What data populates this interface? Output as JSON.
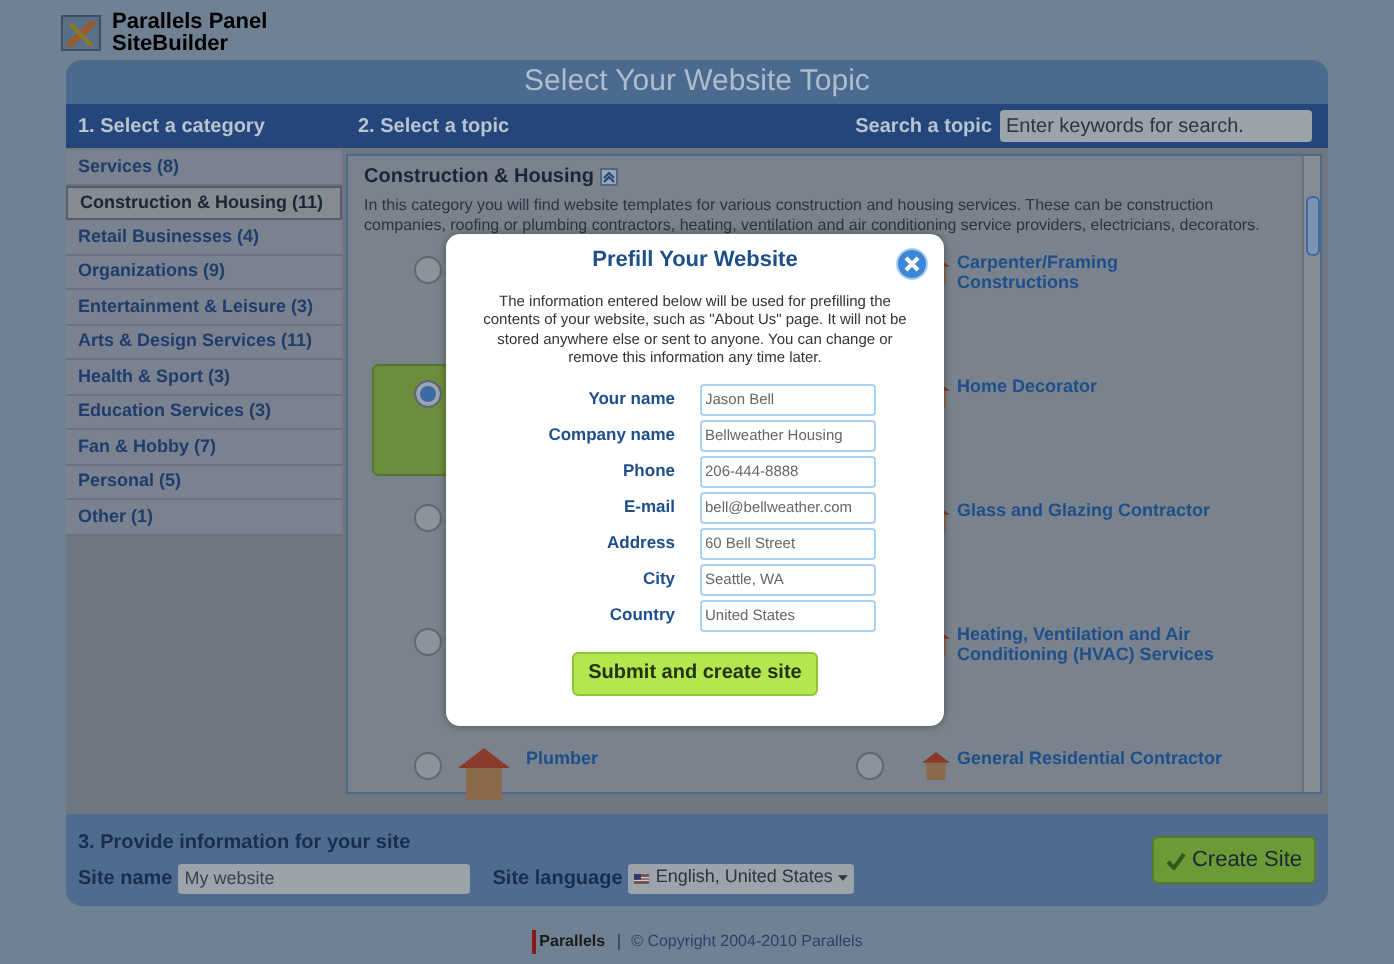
{
  "logo": {
    "line1": "Parallels Panel",
    "line2": "SiteBuilder"
  },
  "title": "Select Your Website Topic",
  "step1": "1. Select a category",
  "step2": "2. Select a topic",
  "search": {
    "label": "Search a topic",
    "placeholder": "Enter keywords for search."
  },
  "categories": [
    {
      "label": "Services (8)",
      "selected": false
    },
    {
      "label": "Construction & Housing (11)",
      "selected": true
    },
    {
      "label": "Retail Businesses (4)",
      "selected": false
    },
    {
      "label": "Organizations (9)",
      "selected": false
    },
    {
      "label": "Entertainment & Leisure (3)",
      "selected": false
    },
    {
      "label": "Arts & Design Services (11)",
      "selected": false
    },
    {
      "label": "Health & Sport (3)",
      "selected": false
    },
    {
      "label": "Education Services (3)",
      "selected": false
    },
    {
      "label": "Fan & Hobby (7)",
      "selected": false
    },
    {
      "label": "Personal (5)",
      "selected": false
    },
    {
      "label": "Other (1)",
      "selected": false
    }
  ],
  "category_heading": "Construction & Housing",
  "category_description": "In this category you will find website templates for various construction and housing services. These can be construction companies, roofing or plumbing contractors, heating, ventilation and air conditioning service providers, electricians, decorators.",
  "topics": [
    {
      "selected": false
    },
    {
      "label": "Carpenter/Framing Constructions"
    },
    {
      "selected": true
    },
    {
      "label": "Home Decorator"
    },
    {
      "selected": false
    },
    {
      "label": "Glass and Glazing Contractor"
    },
    {
      "selected": false
    },
    {
      "label": "Heating, Ventilation and Air Conditioning (HVAC) Services"
    },
    {
      "label": "Plumber",
      "selected": false
    },
    {
      "label": "General Residential Contractor",
      "selected": false
    }
  ],
  "step3": "3. Provide information for your site",
  "site_name": {
    "label": "Site name",
    "value": "My website"
  },
  "site_language": {
    "label": "Site language",
    "value": "English, United States"
  },
  "create_button": "Create Site",
  "footer": {
    "brand": "Parallels",
    "copyright": "© Copyright 2004-2010 Parallels"
  },
  "dialog": {
    "title": "Prefill Your Website",
    "intro": "The information entered below will be used for prefilling the contents of your website, such as \"About Us\" page. It will not be stored anywhere else or sent to anyone. You can change or remove this information any time later.",
    "fields": [
      {
        "label": "Your name",
        "value": "Jason Bell"
      },
      {
        "label": "Company name",
        "value": "Bellweather Housing"
      },
      {
        "label": "Phone",
        "value": "206-444-8888"
      },
      {
        "label": "E-mail",
        "value": "bell@bellweather.com"
      },
      {
        "label": "Address",
        "value": "60 Bell Street"
      },
      {
        "label": "City",
        "value": "Seattle, WA"
      },
      {
        "label": "Country",
        "value": "United States"
      }
    ],
    "submit": "Submit and create site"
  }
}
